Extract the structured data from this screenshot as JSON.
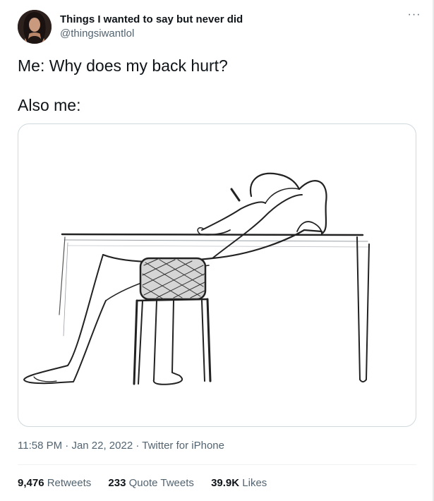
{
  "author": {
    "display_name": "Things I wanted to say but never did",
    "handle": "@thingsiwantlol"
  },
  "more_icon": "more-horizontal-icon",
  "tweet": {
    "line1": "Me: Why does my back hurt?",
    "line2": "Also me:"
  },
  "media": {
    "description_icon": "sketch-person-slouched-over-desk"
  },
  "meta": {
    "time": "11:58 PM",
    "separator1": " · ",
    "date": "Jan 22, 2022",
    "separator2": " · ",
    "source": "Twitter for iPhone"
  },
  "stats": {
    "retweets_count": "9,476",
    "retweets_label": "Retweets",
    "quotes_count": "233",
    "quotes_label": "Quote Tweets",
    "likes_count": "39.9K",
    "likes_label": "Likes"
  },
  "colors": {
    "text": "#0f1419",
    "secondary": "#536471",
    "border": "#cfd9de"
  }
}
